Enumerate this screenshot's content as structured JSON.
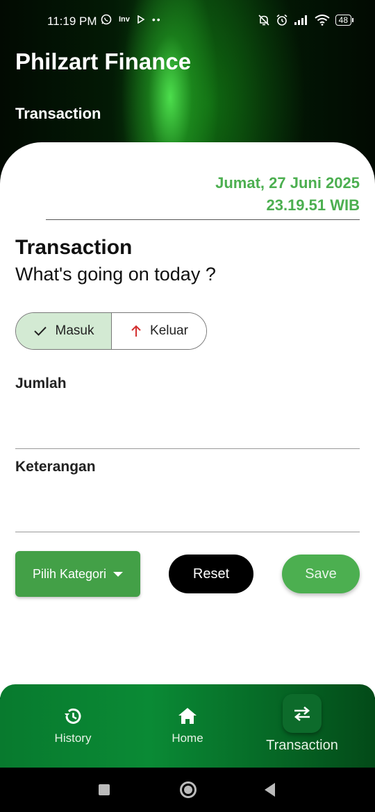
{
  "status_bar": {
    "time": "11:19 PM",
    "app_icons": [
      "whatsapp-icon",
      "inv-icon",
      "play-icon",
      "dots-icon"
    ],
    "inv_text": "Inv",
    "battery": "48"
  },
  "header": {
    "app_title": "Philzart Finance",
    "section_title": "Transaction"
  },
  "datetime": {
    "date": "Jumat, 27 Juni 2025",
    "time": "23.19.51 WIB"
  },
  "form": {
    "heading": "Transaction",
    "subheading": "What's going on today ?",
    "toggle": {
      "in_label": "Masuk",
      "out_label": "Keluar",
      "selected": "Masuk"
    },
    "amount_label": "Jumlah",
    "amount_value": "",
    "note_label": "Keterangan",
    "note_value": "",
    "category_button": "Pilih Kategori",
    "reset_button": "Reset",
    "save_button": "Save"
  },
  "bottom_nav": {
    "items": [
      {
        "label": "History",
        "icon": "history-icon"
      },
      {
        "label": "Home",
        "icon": "home-icon"
      },
      {
        "label": "Transaction",
        "icon": "swap-icon"
      }
    ],
    "active": "Transaction"
  },
  "colors": {
    "accent": "#4caf50",
    "category_button": "#43a047",
    "toggle_selected": "#d3ead3",
    "keluar_arrow": "#d32f2f",
    "nav_bg": "#087a2e"
  }
}
